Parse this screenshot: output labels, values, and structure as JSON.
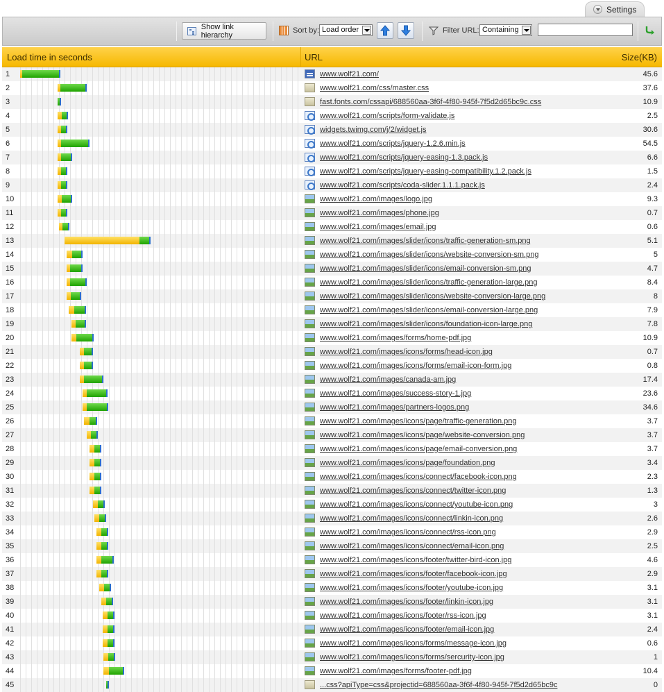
{
  "settings": {
    "label": "Settings"
  },
  "toolbar": {
    "hierarchy_label": "Show link hierarchy",
    "sort_label": "Sort by:",
    "sort_value": "Load order",
    "filter_label": "Filter URL:",
    "filter_value": "Containing",
    "filter_text": ""
  },
  "table": {
    "col_time": "Load time in seconds",
    "col_url": "URL",
    "col_size": "Size(KB)"
  },
  "colors": {
    "header": "#f6b800",
    "wait": "#f2b400",
    "receive": "#1fa300",
    "end": "#2a6fcc"
  },
  "rows": [
    {
      "n": "1",
      "type": "html",
      "url": "www.wolf21.com/",
      "size": "45.6",
      "start": 0,
      "wait": 0.5,
      "recv": 10.5
    },
    {
      "n": "2",
      "type": "css",
      "url": "www.wolf21.com/css/master.css",
      "size": "37.6",
      "start": 10.8,
      "wait": 0.8,
      "recv": 7.2
    },
    {
      "n": "3",
      "type": "css",
      "url": "fast.fonts.com/cssapi/688560aa-3f6f-4f80-945f-7f5d2d65bc9c.css",
      "size": "10.9",
      "start": 10.8,
      "wait": 0,
      "recv": 0.5
    },
    {
      "n": "4",
      "type": "js",
      "url": "www.wolf21.com/scripts/form-validate.js",
      "size": "2.5",
      "start": 10.8,
      "wait": 1.2,
      "recv": 1.4
    },
    {
      "n": "5",
      "type": "js",
      "url": "widgets.twimg.com/j/2/widget.js",
      "size": "30.6",
      "start": 10.8,
      "wait": 1.0,
      "recv": 1.3
    },
    {
      "n": "6",
      "type": "js",
      "url": "www.wolf21.com/scripts/jquery-1.2.6.min.js",
      "size": "54.5",
      "start": 10.8,
      "wait": 1.0,
      "recv": 7.8
    },
    {
      "n": "7",
      "type": "js",
      "url": "www.wolf21.com/scripts/jquery-easing-1.3.pack.js",
      "size": "6.6",
      "start": 10.8,
      "wait": 1.0,
      "recv": 2.8
    },
    {
      "n": "8",
      "type": "js",
      "url": "www.wolf21.com/scripts/jquery-easing-compatibility.1.2.pack.js",
      "size": "1.5",
      "start": 10.8,
      "wait": 1.0,
      "recv": 1.4
    },
    {
      "n": "9",
      "type": "js",
      "url": "www.wolf21.com/scripts/coda-slider.1.1.1.pack.js",
      "size": "2.4",
      "start": 10.8,
      "wait": 1.0,
      "recv": 1.4
    },
    {
      "n": "10",
      "type": "img",
      "url": "www.wolf21.com/images/logo.jpg",
      "size": "9.3",
      "start": 10.8,
      "wait": 1.2,
      "recv": 2.5
    },
    {
      "n": "11",
      "type": "img",
      "url": "www.wolf21.com/images/phone.jpg",
      "size": "0.7",
      "start": 10.8,
      "wait": 1.0,
      "recv": 1.4
    },
    {
      "n": "12",
      "type": "img",
      "url": "www.wolf21.com/images/email.jpg",
      "size": "0.6",
      "start": 11.2,
      "wait": 1.0,
      "recv": 1.5
    },
    {
      "n": "13",
      "type": "img",
      "url": "www.wolf21.com/images/slider/icons/traffic-generation-sm.png",
      "size": "5.1",
      "start": 12.8,
      "wait": 21.5,
      "recv": 2.7
    },
    {
      "n": "14",
      "type": "img",
      "url": "www.wolf21.com/images/slider/icons/website-conversion-sm.png",
      "size": "5",
      "start": 13.3,
      "wait": 1.5,
      "recv": 2.6
    },
    {
      "n": "15",
      "type": "img",
      "url": "www.wolf21.com/images/slider/icons/email-conversion-sm.png",
      "size": "4.7",
      "start": 13.3,
      "wait": 1.0,
      "recv": 3.2
    },
    {
      "n": "16",
      "type": "img",
      "url": "www.wolf21.com/images/slider/icons/traffic-generation-large.png",
      "size": "8.4",
      "start": 13.3,
      "wait": 1.0,
      "recv": 4.3
    },
    {
      "n": "17",
      "type": "img",
      "url": "www.wolf21.com/images/slider/icons/website-conversion-large.png",
      "size": "8",
      "start": 13.3,
      "wait": 1.2,
      "recv": 2.6
    },
    {
      "n": "18",
      "type": "img",
      "url": "www.wolf21.com/images/slider/icons/email-conversion-large.png",
      "size": "7.9",
      "start": 13.9,
      "wait": 1.5,
      "recv": 2.9
    },
    {
      "n": "19",
      "type": "img",
      "url": "www.wolf21.com/images/slider/icons/foundation-icon-large.png",
      "size": "7.8",
      "start": 14.8,
      "wait": 1.2,
      "recv": 2.5
    },
    {
      "n": "20",
      "type": "img",
      "url": "www.wolf21.com/images/forms/home-pdf.jpg",
      "size": "10.9",
      "start": 14.8,
      "wait": 1.3,
      "recv": 4.5
    },
    {
      "n": "21",
      "type": "img",
      "url": "www.wolf21.com/images/icons/forms/head-icon.jpg",
      "size": "0.7",
      "start": 17.1,
      "wait": 1.1,
      "recv": 2.1
    },
    {
      "n": "22",
      "type": "img",
      "url": "www.wolf21.com/images/icons/forms/email-icon-form.jpg",
      "size": "0.8",
      "start": 17.1,
      "wait": 1.1,
      "recv": 2.2
    },
    {
      "n": "23",
      "type": "img",
      "url": "www.wolf21.com/images/canada-am.jpg",
      "size": "17.4",
      "start": 17.1,
      "wait": 1.1,
      "recv": 5.1
    },
    {
      "n": "24",
      "type": "img",
      "url": "www.wolf21.com/images/success-story-1.jpg",
      "size": "23.6",
      "start": 17.9,
      "wait": 1.1,
      "recv": 5.5
    },
    {
      "n": "25",
      "type": "img",
      "url": "www.wolf21.com/images/partners-logos.png",
      "size": "34.6",
      "start": 17.9,
      "wait": 1.1,
      "recv": 5.7
    },
    {
      "n": "26",
      "type": "img",
      "url": "www.wolf21.com/images/icons/page/traffic-generation.png",
      "size": "3.7",
      "start": 18.4,
      "wait": 1.6,
      "recv": 1.7
    },
    {
      "n": "27",
      "type": "img",
      "url": "www.wolf21.com/images/icons/page/website-conversion.png",
      "size": "3.7",
      "start": 19.1,
      "wait": 1.2,
      "recv": 1.6
    },
    {
      "n": "28",
      "type": "img",
      "url": "www.wolf21.com/images/icons/page/email-conversion.png",
      "size": "3.7",
      "start": 20.0,
      "wait": 1.3,
      "recv": 1.6
    },
    {
      "n": "29",
      "type": "img",
      "url": "www.wolf21.com/images/icons/page/foundation.png",
      "size": "3.4",
      "start": 20.0,
      "wait": 1.3,
      "recv": 1.6
    },
    {
      "n": "30",
      "type": "img",
      "url": "www.wolf21.com/images/icons/connect/facebook-icon.png",
      "size": "2.3",
      "start": 20.0,
      "wait": 1.3,
      "recv": 1.6
    },
    {
      "n": "31",
      "type": "img",
      "url": "www.wolf21.com/images/icons/connect/twitter-icon.png",
      "size": "1.3",
      "start": 20.0,
      "wait": 1.3,
      "recv": 1.6
    },
    {
      "n": "32",
      "type": "img",
      "url": "www.wolf21.com/images/icons/connect/youtube-icon.png",
      "size": "3",
      "start": 20.9,
      "wait": 1.3,
      "recv": 1.6
    },
    {
      "n": "33",
      "type": "img",
      "url": "www.wolf21.com/images/icons/connect/linkin-icon.png",
      "size": "2.6",
      "start": 21.3,
      "wait": 1.3,
      "recv": 1.6
    },
    {
      "n": "34",
      "type": "img",
      "url": "www.wolf21.com/images/icons/connect/rss-icon.png",
      "size": "2.9",
      "start": 22.0,
      "wait": 1.3,
      "recv": 1.6
    },
    {
      "n": "35",
      "type": "img",
      "url": "www.wolf21.com/images/icons/connect/email-icon.png",
      "size": "2.5",
      "start": 22.0,
      "wait": 1.3,
      "recv": 1.6
    },
    {
      "n": "36",
      "type": "img",
      "url": "www.wolf21.com/images/icons/footer/twitter-bird-icon.jpg",
      "size": "4.6",
      "start": 22.0,
      "wait": 1.3,
      "recv": 3.2
    },
    {
      "n": "37",
      "type": "img",
      "url": "www.wolf21.com/images/icons/footer/facebook-icon.jpg",
      "size": "2.9",
      "start": 22.0,
      "wait": 1.3,
      "recv": 1.6
    },
    {
      "n": "38",
      "type": "img",
      "url": "www.wolf21.com/images/icons/footer/youtube-icon.jpg",
      "size": "3.1",
      "start": 22.7,
      "wait": 1.3,
      "recv": 1.6
    },
    {
      "n": "39",
      "type": "img",
      "url": "www.wolf21.com/images/icons/footer/linkin-icon.jpg",
      "size": "3.1",
      "start": 23.4,
      "wait": 1.3,
      "recv": 1.6
    },
    {
      "n": "40",
      "type": "img",
      "url": "www.wolf21.com/images/icons/footer/rss-icon.jpg",
      "size": "3.1",
      "start": 23.7,
      "wait": 1.3,
      "recv": 1.6
    },
    {
      "n": "41",
      "type": "img",
      "url": "www.wolf21.com/images/icons/footer/email-icon.jpg",
      "size": "2.4",
      "start": 23.7,
      "wait": 1.3,
      "recv": 1.6
    },
    {
      "n": "42",
      "type": "img",
      "url": "www.wolf21.com/images/icons/forms/message-icon.jpg",
      "size": "0.6",
      "start": 23.7,
      "wait": 1.3,
      "recv": 1.6
    },
    {
      "n": "43",
      "type": "img",
      "url": "www.wolf21.com/images/icons/forms/sercurity-icon.jpg",
      "size": "1",
      "start": 24.0,
      "wait": 1.3,
      "recv": 1.6
    },
    {
      "n": "44",
      "type": "img",
      "url": "www.wolf21.com/images/forms/footer-pdf.jpg",
      "size": "10.4",
      "start": 24.0,
      "wait": 1.6,
      "recv": 3.9
    },
    {
      "n": "45",
      "type": "css",
      "url": "...css?apiType=css&projectid=688560aa-3f6f-4f80-945f-7f5d2d65bc9c",
      "size": "0",
      "start": 24.7,
      "wait": 0,
      "recv": 0.3
    }
  ]
}
